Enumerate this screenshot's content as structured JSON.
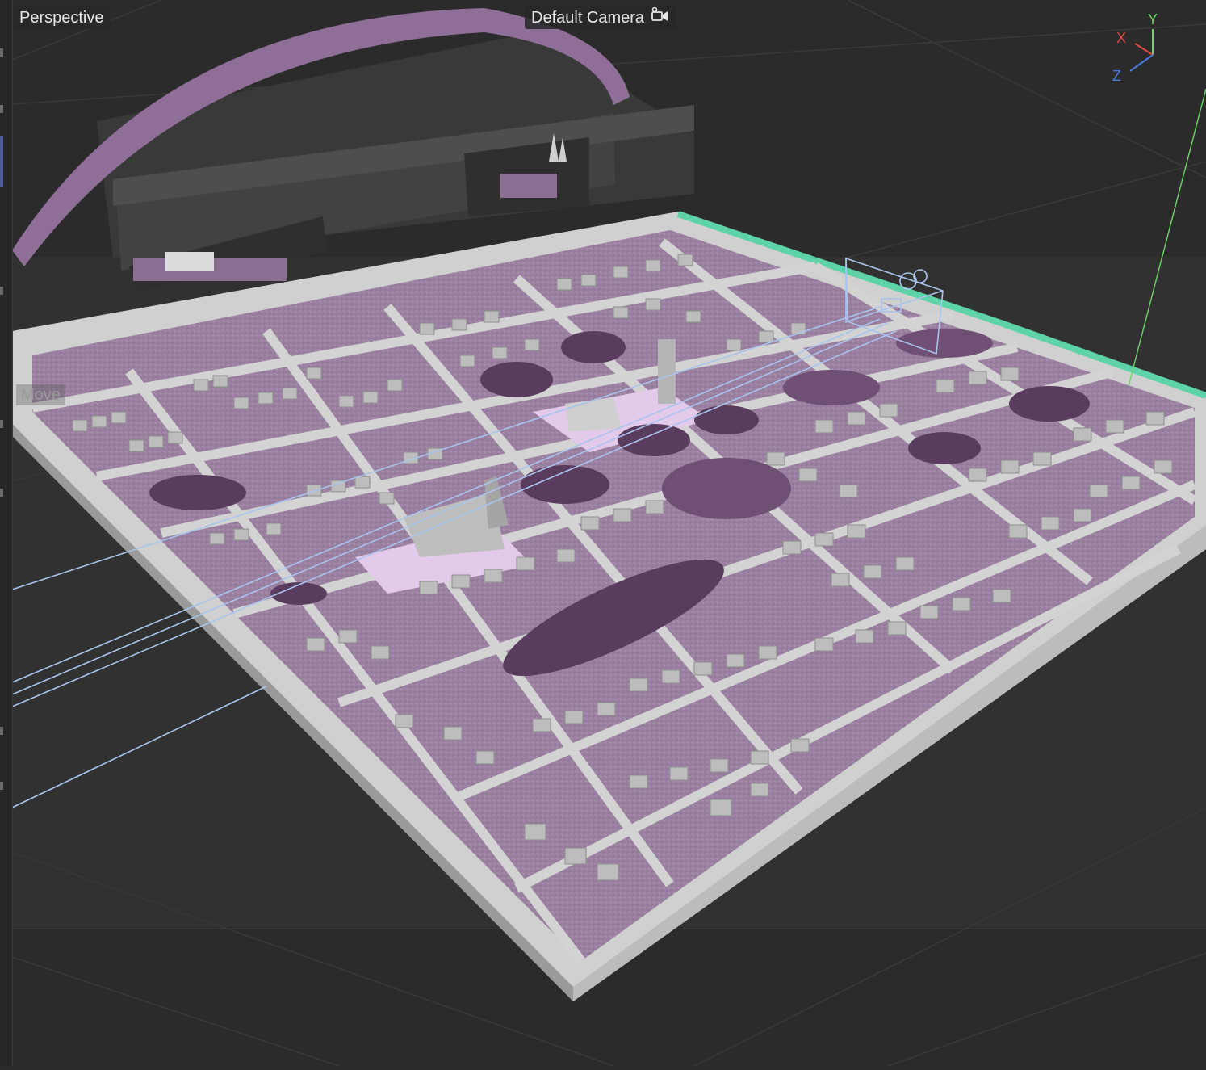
{
  "viewport": {
    "view_mode": "Perspective",
    "camera": "Default Camera",
    "camera_icon": "camera-lock-icon",
    "tool_hint": "Move"
  },
  "axis_gizmo": {
    "x": "X",
    "y": "Y",
    "z": "Z"
  },
  "colors": {
    "background": "#2b2b2b",
    "ground": "#9b7fa2",
    "road": "#cfcfcf",
    "building": "#bdbdbd",
    "tree": "#5a3c5e",
    "selection": "#a9c4ee",
    "axis_x": "#e04747",
    "axis_y": "#6dd36a",
    "axis_z": "#4a7cdf",
    "edge_highlight": "#5fd3a8"
  }
}
